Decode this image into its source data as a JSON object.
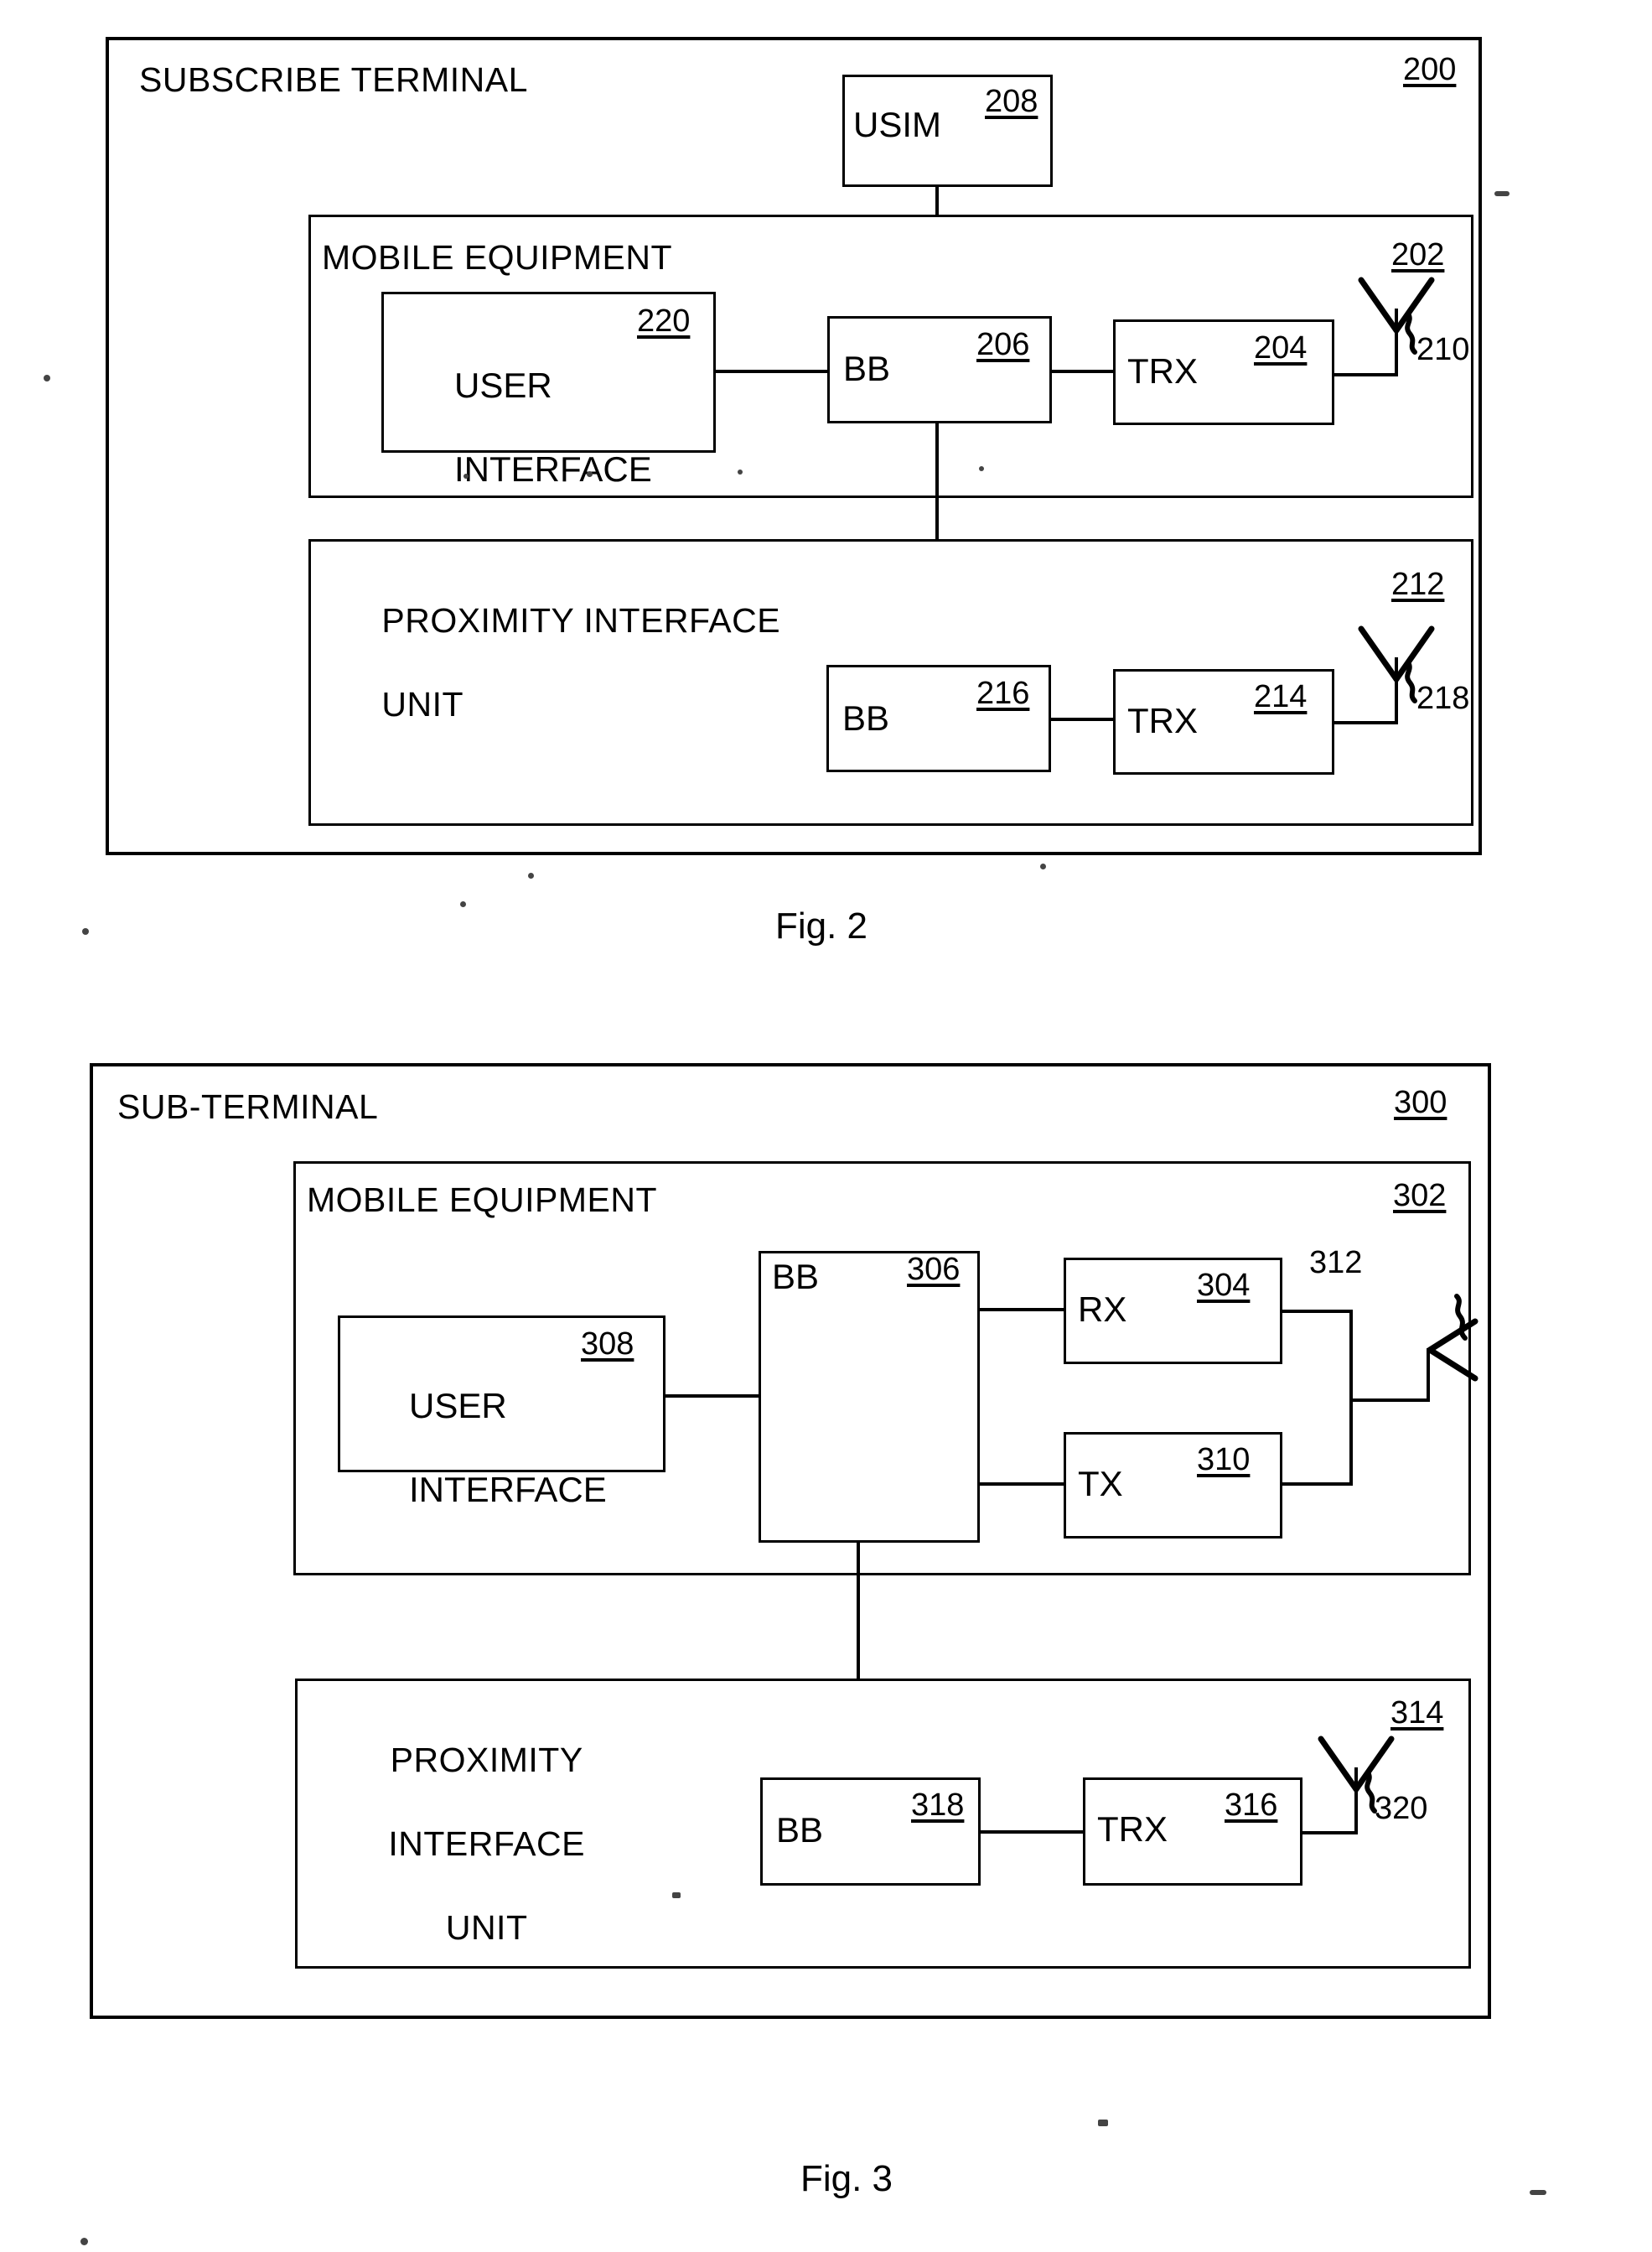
{
  "document": {
    "type": "patent-figure-sheet",
    "figures": [
      {
        "caption": "Fig. 2",
        "outer_label": "SUBSCRIBE TERMINAL",
        "outer_ref": "200",
        "usim": {
          "label": "USIM",
          "ref": "208"
        },
        "mobile_equipment": {
          "label": "MOBILE EQUIPMENT",
          "ref": "202",
          "user_interface": {
            "line1": "USER",
            "line2": "INTERFACE",
            "ref": "220"
          },
          "bb": {
            "label": "BB",
            "ref": "206"
          },
          "trx": {
            "label": "TRX",
            "ref": "204"
          },
          "antenna_ref": "210"
        },
        "proximity_interface_unit": {
          "line1": "PROXIMITY INTERFACE",
          "line2": "UNIT",
          "ref": "212",
          "bb": {
            "label": "BB",
            "ref": "216"
          },
          "trx": {
            "label": "TRX",
            "ref": "214"
          },
          "antenna_ref": "218"
        }
      },
      {
        "caption": "Fig. 3",
        "outer_label": "SUB-TERMINAL",
        "outer_ref": "300",
        "mobile_equipment": {
          "label": "MOBILE EQUIPMENT",
          "ref": "302",
          "user_interface": {
            "line1": "USER",
            "line2": "INTERFACE",
            "ref": "308"
          },
          "bb": {
            "label": "BB",
            "ref": "306"
          },
          "rx": {
            "label": "RX",
            "ref": "304"
          },
          "tx": {
            "label": "TX",
            "ref": "310"
          },
          "antenna_ref": "312"
        },
        "proximity_interface_unit": {
          "line1": "PROXIMITY",
          "line2": "INTERFACE",
          "line3": "UNIT",
          "ref": "314",
          "bb": {
            "label": "BB",
            "ref": "318"
          },
          "trx": {
            "label": "TRX",
            "ref": "316"
          },
          "antenna_ref": "320"
        }
      }
    ],
    "colors": {
      "ink": "#000000",
      "paper": "#ffffff"
    }
  }
}
